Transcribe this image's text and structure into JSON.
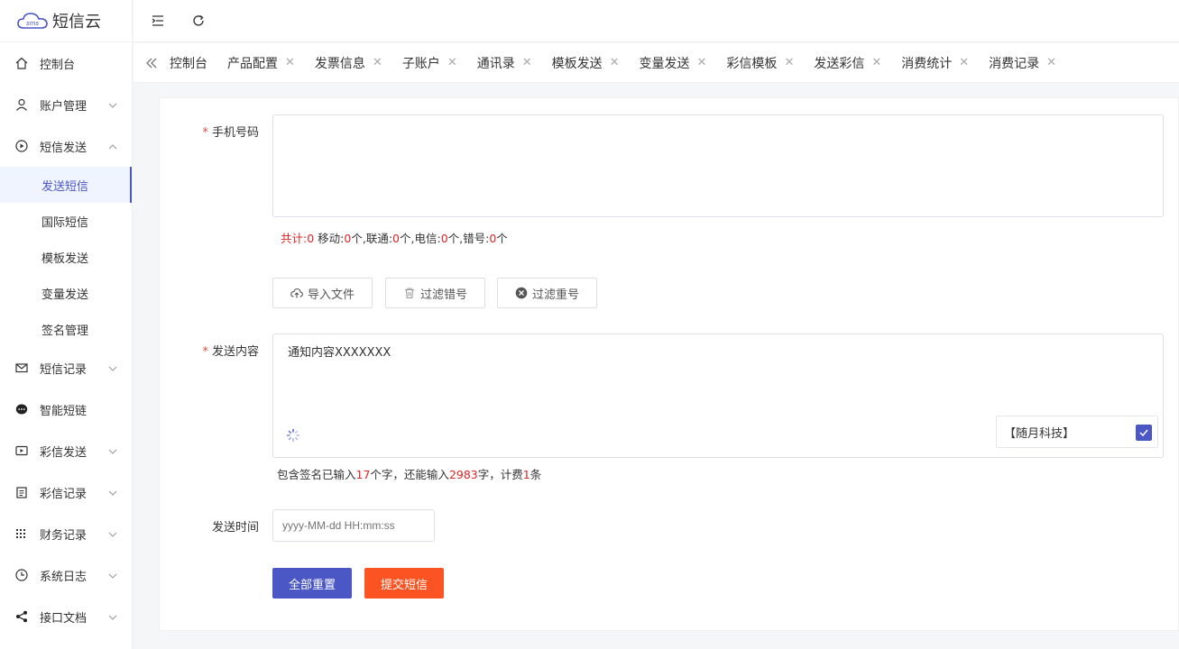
{
  "app": {
    "logo_text": "短信云",
    "logo_badge": "sms"
  },
  "sidebar": {
    "items": [
      {
        "label": "控制台",
        "icon": "home-icon"
      },
      {
        "label": "账户管理",
        "icon": "user-icon"
      },
      {
        "label": "短信发送",
        "icon": "play-circle-icon"
      },
      {
        "label": "短信记录",
        "icon": "mail-icon"
      },
      {
        "label": "智能短链",
        "icon": "chat-bubble-icon"
      },
      {
        "label": "彩信发送",
        "icon": "video-icon"
      },
      {
        "label": "彩信记录",
        "icon": "clipboard-icon"
      },
      {
        "label": "财务记录",
        "icon": "grid-icon"
      },
      {
        "label": "系统日志",
        "icon": "clock-icon"
      },
      {
        "label": "接口文档",
        "icon": "share-icon"
      }
    ],
    "sub_items": [
      {
        "label": "发送短信",
        "active": true
      },
      {
        "label": "国际短信"
      },
      {
        "label": "模板发送"
      },
      {
        "label": "变量发送"
      },
      {
        "label": "签名管理"
      }
    ]
  },
  "tabs": [
    {
      "label": "控制台",
      "closable": false
    },
    {
      "label": "产品配置",
      "closable": true
    },
    {
      "label": "发票信息",
      "closable": true
    },
    {
      "label": "子账户",
      "closable": true
    },
    {
      "label": "通讯录",
      "closable": true
    },
    {
      "label": "模板发送",
      "closable": true
    },
    {
      "label": "变量发送",
      "closable": true
    },
    {
      "label": "彩信模板",
      "closable": true
    },
    {
      "label": "发送彩信",
      "closable": true
    },
    {
      "label": "消费统计",
      "closable": true
    },
    {
      "label": "消费记录",
      "closable": true
    }
  ],
  "form": {
    "phone_label": "手机号码",
    "phone_value": "",
    "stats": {
      "total_label": "共计:",
      "total": "0",
      "mobile_label": "移动:",
      "mobile": "0",
      "unit1": "个,",
      "unicom_label": "联通:",
      "unicom": "0",
      "unit2": "个,",
      "telecom_label": "电信:",
      "telecom": "0",
      "unit3": "个,",
      "wrong_label": "错号:",
      "wrong": "0",
      "unit4": "个"
    },
    "import_btn": "导入文件",
    "filter_wrong_btn": "过滤错号",
    "filter_dup_btn": "过滤重号",
    "content_label": "发送内容",
    "content_value": "通知内容XXXXXXX",
    "signature": "【随月科技】",
    "count": {
      "pre": "包含签名已输入",
      "entered": "17",
      "mid": "个字，还能输入",
      "remaining": "2983",
      "mid2": "字，计费",
      "billed": "1",
      "post": "条"
    },
    "time_label": "发送时间",
    "time_placeholder": "yyyy-MM-dd HH:mm:ss",
    "reset_btn": "全部重置",
    "submit_btn": "提交短信"
  },
  "colors": {
    "accent": "#4a57c5",
    "submit": "#fb5422",
    "required": "#e74c3c",
    "highlight": "#e02424"
  }
}
